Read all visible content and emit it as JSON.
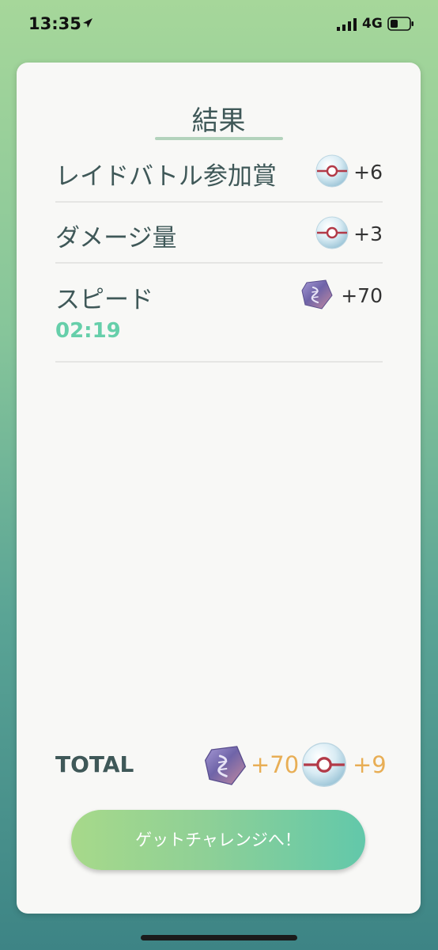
{
  "status_bar": {
    "time": "13:35",
    "network": "4G"
  },
  "results": {
    "title": "結果",
    "rows": [
      {
        "label": "レイドバトル参加賞",
        "icon": "premier-ball-icon",
        "value": "+6"
      },
      {
        "label": "ダメージ量",
        "icon": "premier-ball-icon",
        "value": "+3"
      },
      {
        "label": "スピード",
        "icon": "rare-candy-icon",
        "value": "+70",
        "sub": "02:19"
      }
    ],
    "total": {
      "label": "TOTAL",
      "candy": {
        "icon": "rare-candy-icon",
        "value": "+70"
      },
      "balls": {
        "icon": "premier-ball-icon",
        "value": "+9"
      }
    },
    "cta_label": "ゲットチャレンジへ！"
  },
  "colors": {
    "accent_green": "#66cfaa",
    "total_gold": "#e8ae55",
    "title_text": "#3f5858"
  }
}
